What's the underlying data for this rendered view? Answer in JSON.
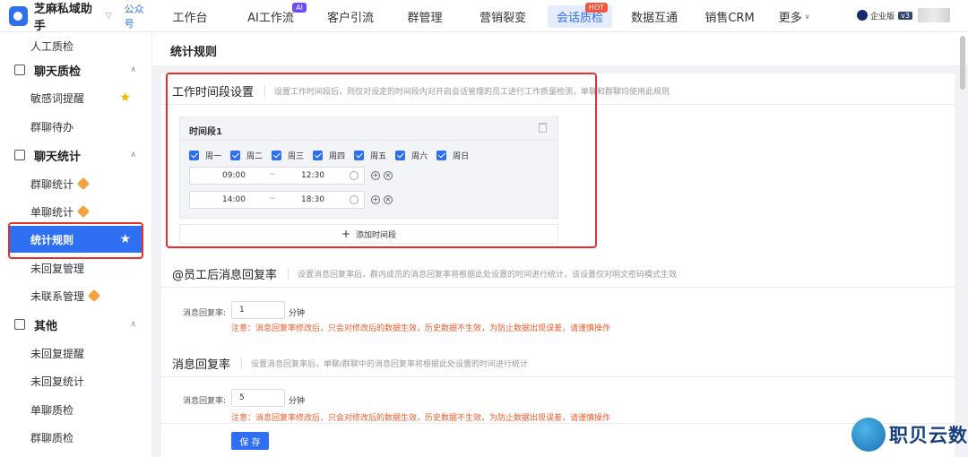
{
  "brand": {
    "name": "芝麻私域助手",
    "tag": "公众号"
  },
  "nav": {
    "items": [
      {
        "label": "工作台"
      },
      {
        "label": "AI工作流",
        "badge": "AI"
      },
      {
        "label": "客户引流"
      },
      {
        "label": "群管理"
      },
      {
        "label": "营销裂变"
      },
      {
        "label": "会话质检",
        "badge": "HOT",
        "active": true
      },
      {
        "label": "数据互通"
      },
      {
        "label": "销售CRM"
      },
      {
        "label": "更多"
      }
    ]
  },
  "user": {
    "enterprise_label": "企业版",
    "version": "v3"
  },
  "sidebar": {
    "items": [
      {
        "label": "人工质检"
      },
      {
        "label": "聊天质检",
        "group": true
      },
      {
        "label": "敏感词提醒",
        "starred": true
      },
      {
        "label": "群聊待办"
      },
      {
        "label": "聊天统计",
        "group": true
      },
      {
        "label": "群聊统计",
        "premium": true
      },
      {
        "label": "单聊统计",
        "premium": true
      },
      {
        "label": "统计规则",
        "active": true,
        "starred": true
      },
      {
        "label": "未回复管理"
      },
      {
        "label": "未联系管理",
        "premium": true
      },
      {
        "label": "其他",
        "group": true
      },
      {
        "label": "未回复提醒"
      },
      {
        "label": "未回复统计"
      },
      {
        "label": "单聊质检"
      },
      {
        "label": "群聊质检"
      }
    ]
  },
  "page": {
    "title": "统计规则"
  },
  "work_period": {
    "title": "工作时间段设置",
    "desc": "设置工作时间段后，则仅对设定的时间段内对开启会话管理的员工进行工作质量检测，单聊和群聊均使用此规则",
    "period_title": "时间段1",
    "days": [
      "周一",
      "周二",
      "周三",
      "周四",
      "周五",
      "周六",
      "周日"
    ],
    "ranges": [
      {
        "start": "09:00",
        "sep": "~",
        "end": "12:30"
      },
      {
        "start": "14:00",
        "sep": "~",
        "end": "18:30"
      }
    ],
    "add_label": "添加时间段"
  },
  "staff_reply": {
    "title": "@员工后消息回复率",
    "desc": "设置消息回复率后，群内成员的消息回复率将根据此处设置的时间进行统计，该设置仅对明文密码模式生效",
    "field_label": "消息回复率:",
    "value": "1",
    "unit": "分钟",
    "warning": "注意：消息回复率修改后，只会对修改后的数据生效，历史数据不生效，为防止数据出现误差，请谨慎操作"
  },
  "msg_reply": {
    "title": "消息回复率",
    "desc": "设置消息回复率后，单聊/群聊中的消息回复率将根据此处设置的时间进行统计",
    "field_label": "消息回复率:",
    "value": "5",
    "unit": "分钟",
    "warning": "注意：消息回复率修改后，只会对修改后的数据生效，历史数据不生效，为防止数据出现误差，请谨慎操作"
  },
  "save_label": "保 存",
  "watermark": {
    "text": "职贝云数"
  },
  "colors": {
    "primary": "#2f6ff2",
    "highlight": "#e2312d",
    "warning": "#f05a2b"
  }
}
